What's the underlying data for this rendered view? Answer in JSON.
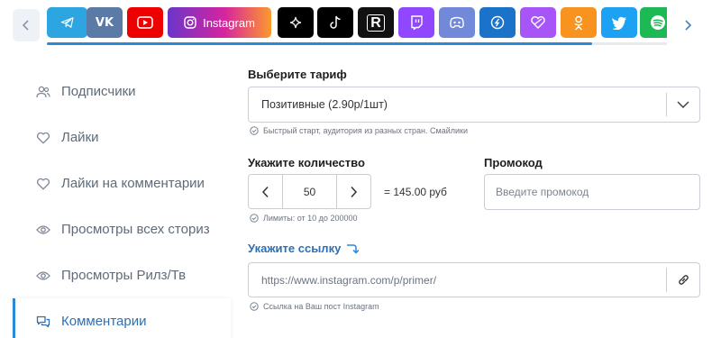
{
  "platforms": [
    {
      "name": "telegram",
      "icon": "telegram-icon",
      "color": "#2ca5e0",
      "selected": false
    },
    {
      "name": "vk",
      "icon": "vk-icon",
      "color": "#5b7aa6",
      "selected": false
    },
    {
      "name": "youtube",
      "icon": "youtube-icon",
      "color": "#ee0000",
      "selected": false
    },
    {
      "name": "instagram",
      "icon": "instagram-icon",
      "label": "Instagram",
      "color": "#d6249f",
      "selected": true
    },
    {
      "name": "spark",
      "icon": "sparkle-icon",
      "color": "#000000",
      "selected": false
    },
    {
      "name": "tiktok",
      "icon": "tiktok-icon",
      "color": "#000000",
      "selected": false
    },
    {
      "name": "rutube",
      "icon": "rutube-icon",
      "color": "#111111",
      "selected": false
    },
    {
      "name": "twitch",
      "icon": "twitch-icon",
      "color": "#9146ff",
      "selected": false
    },
    {
      "name": "discord",
      "icon": "discord-icon",
      "color": "#7289da",
      "selected": false
    },
    {
      "name": "likee",
      "icon": "likee-icon",
      "color": "#1a73c9",
      "selected": false
    },
    {
      "name": "likes",
      "icon": "heart-line-icon",
      "color": "#a855f7",
      "selected": false
    },
    {
      "name": "odnoklassniki",
      "icon": "odnoklassniki-icon",
      "color": "#f7931e",
      "selected": false
    },
    {
      "name": "twitter",
      "icon": "twitter-icon",
      "color": "#1da1f2",
      "selected": false
    },
    {
      "name": "spotify",
      "icon": "spotify-icon",
      "color": "#1db954",
      "selected": false
    }
  ],
  "scroll_progress": 0.88,
  "sidebar": {
    "items": [
      {
        "label": "Подписчики",
        "icon": "users-icon",
        "active": false
      },
      {
        "label": "Лайки",
        "icon": "heart-icon",
        "active": false
      },
      {
        "label": "Лайки на комментарии",
        "icon": "heart-icon",
        "active": false
      },
      {
        "label": "Просмотры всех сториз",
        "icon": "eye-icon",
        "active": false
      },
      {
        "label": "Просмотры Рилз/Тв",
        "icon": "eye-icon",
        "active": false
      },
      {
        "label": "Комментарии",
        "icon": "comments-icon",
        "active": true
      }
    ]
  },
  "form": {
    "tariff_label": "Выберите тариф",
    "tariff_value": "Позитивные (2.90р/1шт)",
    "tariff_hint": "Быстрый старт, аудитория из разных стран. Смайлики",
    "quantity_label": "Укажите количество",
    "quantity_value": "50",
    "total": "= 145.00 руб",
    "quantity_hint": "Лимиты: от 10 до 200000",
    "promo_label": "Промокод",
    "promo_placeholder": "Введите промокод",
    "link_label": "Укажите ссылку",
    "link_placeholder": "https://www.instagram.com/p/primer/",
    "link_hint": "Ссылка на Ваш пост Instagram"
  },
  "colors": {
    "accent": "#2d88d8",
    "accent_dark": "#2d6fb3"
  }
}
